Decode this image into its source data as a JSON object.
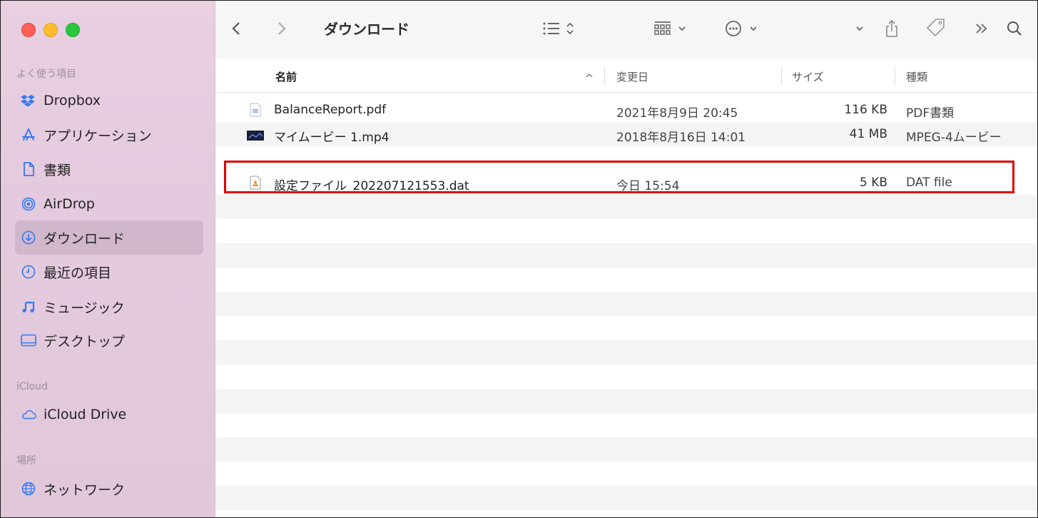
{
  "sidebar": {
    "favorites_label": "よく使う項目",
    "favorites": [
      {
        "label": "Dropbox",
        "icon": "dropbox-icon"
      },
      {
        "label": "アプリケーション",
        "icon": "applications-icon"
      },
      {
        "label": "書類",
        "icon": "document-icon"
      },
      {
        "label": "AirDrop",
        "icon": "airdrop-icon"
      },
      {
        "label": "ダウンロード",
        "icon": "download-icon",
        "selected": true
      },
      {
        "label": "最近の項目",
        "icon": "clock-icon"
      },
      {
        "label": "ミュージック",
        "icon": "music-icon"
      },
      {
        "label": "デスクトップ",
        "icon": "desktop-icon"
      }
    ],
    "icloud_label": "iCloud",
    "icloud": [
      {
        "label": "iCloud Drive",
        "icon": "cloud-icon"
      }
    ],
    "locations_label": "場所",
    "locations": [
      {
        "label": "ネットワーク",
        "icon": "network-icon"
      }
    ]
  },
  "toolbar": {
    "title": "ダウンロード"
  },
  "columns": {
    "name": "名前",
    "date": "変更日",
    "size": "サイズ",
    "kind": "種類"
  },
  "files": [
    {
      "name": "BalanceReport.pdf",
      "date": "2021年8月9日 20:45",
      "size": "116 KB",
      "kind": "PDF書類",
      "icon": "pdf-file-icon"
    },
    {
      "name": "マイムービー 1.mp4",
      "date": "2018年8月16日 14:01",
      "size": "41 MB",
      "kind": "MPEG-4ムービー",
      "icon": "movie-file-icon"
    },
    {
      "name": "設定ファイル_202207121553.dat",
      "date": "今日 15:54",
      "size": "5 KB",
      "kind": "DAT file",
      "icon": "dat-file-icon",
      "highlighted": true
    }
  ],
  "colors": {
    "accent": "#3478f6",
    "highlight_border": "#e10000"
  }
}
